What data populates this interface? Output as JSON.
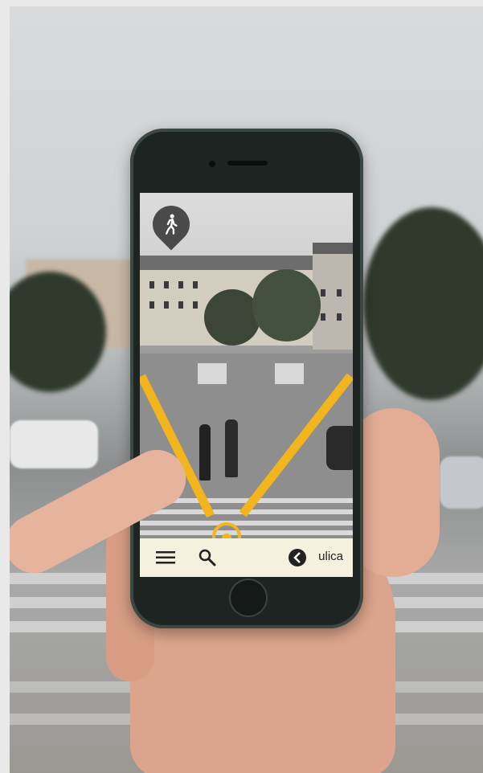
{
  "screen": {
    "bottom_bar": {
      "menu_icon": "hamburger-menu-icon",
      "search_icon": "search-icon",
      "back_icon": "chevron-left-icon",
      "street_label": "ulica"
    },
    "pin_icon": "pedestrian-walk-icon",
    "accent_color": "#f2b51d"
  }
}
